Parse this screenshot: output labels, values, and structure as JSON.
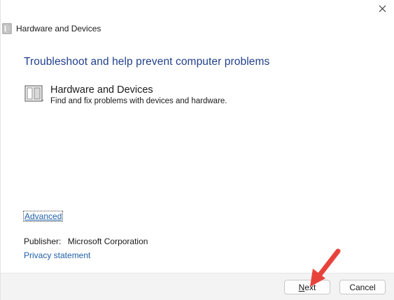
{
  "window": {
    "title": "Hardware and Devices",
    "close_glyph": "✕"
  },
  "content": {
    "heading": "Troubleshoot and help prevent computer problems",
    "item": {
      "title": "Hardware and Devices",
      "description": "Find and fix problems with devices and hardware.",
      "icon": "hardware-device-icon"
    },
    "advanced_label": "Advanced",
    "publisher_label": "Publisher:",
    "publisher_value": "Microsoft Corporation",
    "privacy_label": "Privacy statement"
  },
  "footer": {
    "next_label_mnemonic": "N",
    "next_label_rest": "ext",
    "cancel_label": "Cancel"
  },
  "colors": {
    "heading": "#1f3f8c",
    "link": "#1f5fa8",
    "footer_bg": "#f3f3f3",
    "annotation_arrow": "#e8433b"
  }
}
